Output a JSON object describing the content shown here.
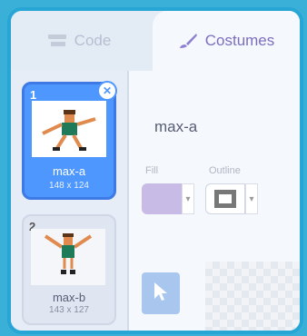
{
  "tabs": [
    {
      "label": "Code",
      "icon": "code-blocks-icon",
      "active": false
    },
    {
      "label": "Costumes",
      "icon": "paintbrush-icon",
      "active": true
    }
  ],
  "costumes": [
    {
      "number": "1",
      "name": "max-a",
      "size": "148 x 124",
      "selected": true
    },
    {
      "number": "2",
      "name": "max-b",
      "size": "143 x 127",
      "selected": false
    }
  ],
  "editor": {
    "costume_name": "max-a",
    "fill_label": "Fill",
    "outline_label": "Outline",
    "fill_color": "#c8bce6",
    "outline_color": "#777777"
  },
  "colors": {
    "accent": "#4d97ff",
    "costumes_tab_text": "#7b6fbf",
    "frame_border": "#27a6d6"
  }
}
